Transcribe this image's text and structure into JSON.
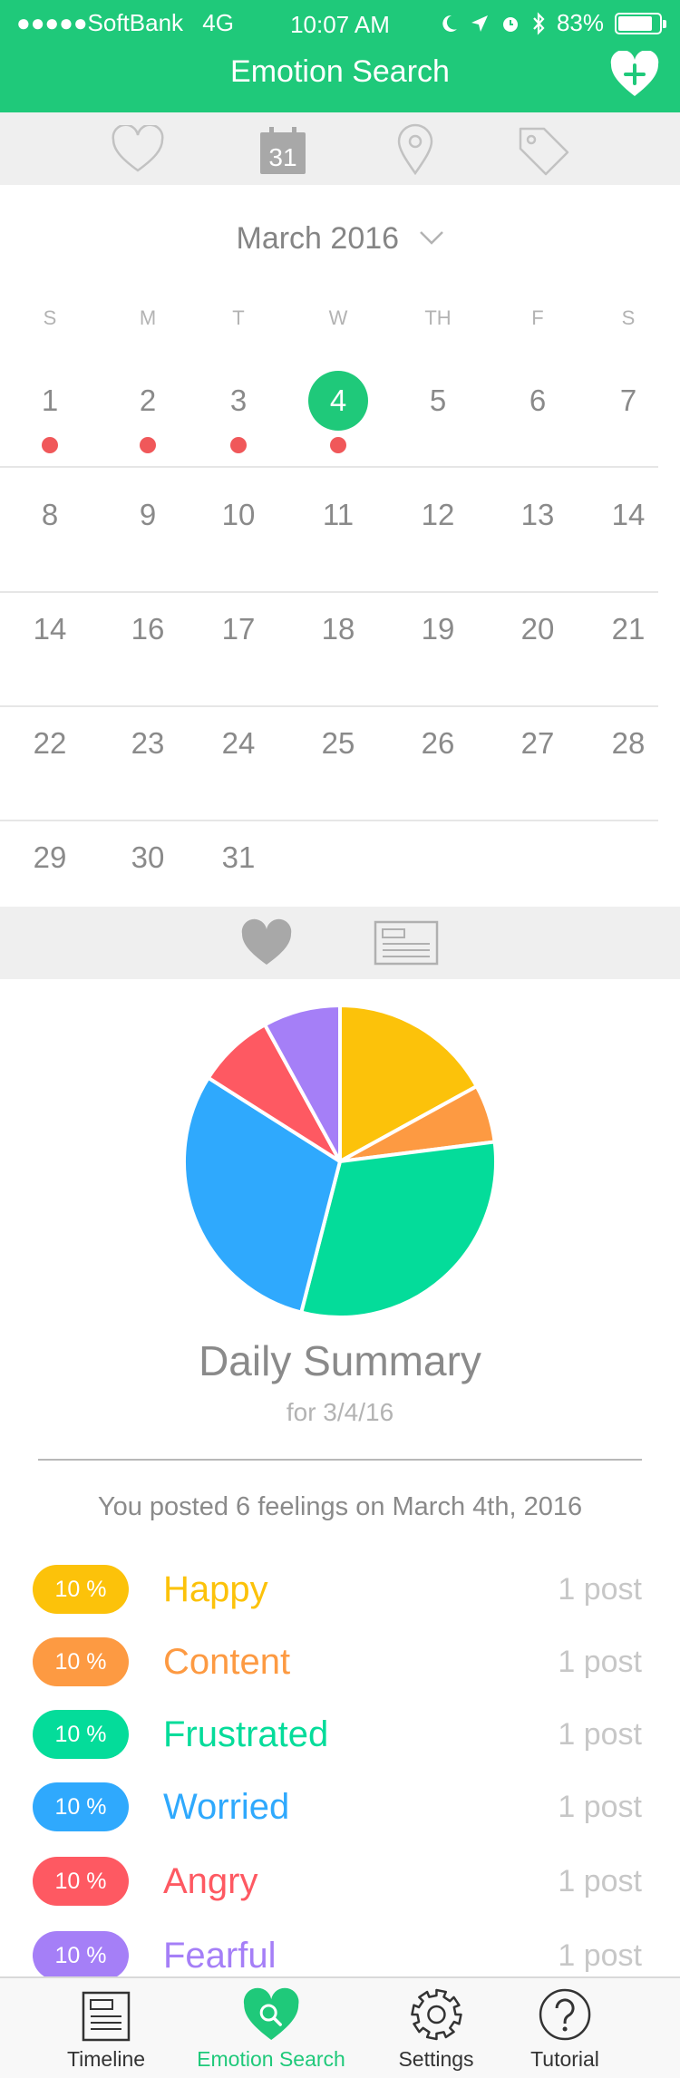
{
  "status": {
    "carrier": "SoftBank",
    "network": "4G",
    "time": "10:07 AM",
    "battery": "83%",
    "battery_level": 0.83
  },
  "header": {
    "title": "Emotion Search"
  },
  "filters": [
    {
      "name": "heart",
      "label": ""
    },
    {
      "name": "calendar",
      "label": "31"
    },
    {
      "name": "location",
      "label": ""
    },
    {
      "name": "tag",
      "label": ""
    }
  ],
  "calendar": {
    "month_label": "March 2016",
    "weekdays": [
      "S",
      "M",
      "T",
      "W",
      "TH",
      "F",
      "S"
    ],
    "weeks": [
      [
        "1",
        "2",
        "3",
        "4",
        "5",
        "6",
        "7"
      ],
      [
        "8",
        "9",
        "10",
        "11",
        "12",
        "13",
        "14"
      ],
      [
        "14",
        "16",
        "17",
        "18",
        "19",
        "20",
        "21"
      ],
      [
        "22",
        "23",
        "24",
        "25",
        "26",
        "27",
        "28"
      ],
      [
        "29",
        "30",
        "31"
      ]
    ],
    "selected_day": "4",
    "days_with_posts": [
      "1",
      "2",
      "3",
      "4"
    ]
  },
  "chart_data": {
    "type": "pie",
    "title": "",
    "slices": [
      {
        "label": "Happy",
        "value": 17,
        "color": "#fcc20a"
      },
      {
        "label": "Content",
        "value": 6,
        "color": "#fd9a42"
      },
      {
        "label": "Frustrated",
        "value": 31,
        "color": "#04dc9a"
      },
      {
        "label": "Worried",
        "value": 30,
        "color": "#2fa9fd"
      },
      {
        "label": "Angry",
        "value": 8,
        "color": "#fe5962"
      },
      {
        "label": "Fearful",
        "value": 8,
        "color": "#a57ff7"
      }
    ]
  },
  "summary": {
    "title": "Daily Summary",
    "subtitle": "for 3/4/16",
    "posted_text": "You posted 6 feelings on March 4th, 2016",
    "emotions": [
      {
        "percent": "10 %",
        "name": "Happy",
        "count": "1 post",
        "color": "#fcc20a"
      },
      {
        "percent": "10 %",
        "name": "Content",
        "count": "1 post",
        "color": "#fd9a42"
      },
      {
        "percent": "10 %",
        "name": "Frustrated",
        "count": "1 post",
        "color": "#04dc9a"
      },
      {
        "percent": "10 %",
        "name": "Worried",
        "count": "1 post",
        "color": "#2fa9fd"
      },
      {
        "percent": "10 %",
        "name": "Angry",
        "count": "1 post",
        "color": "#fe5962"
      },
      {
        "percent": "10 %",
        "name": "Fearful",
        "count": "1 post",
        "color": "#a57ff7"
      }
    ]
  },
  "tabbar": {
    "items": [
      {
        "label": "Timeline",
        "icon": "timeline-icon"
      },
      {
        "label": "Emotion Search",
        "icon": "emotion-search-icon"
      },
      {
        "label": "Settings",
        "icon": "gear-icon"
      },
      {
        "label": "Tutorial",
        "icon": "question-icon"
      }
    ],
    "active_index": 1
  },
  "colors": {
    "brand": "#1fc97a",
    "post_dot": "#f0585a"
  }
}
